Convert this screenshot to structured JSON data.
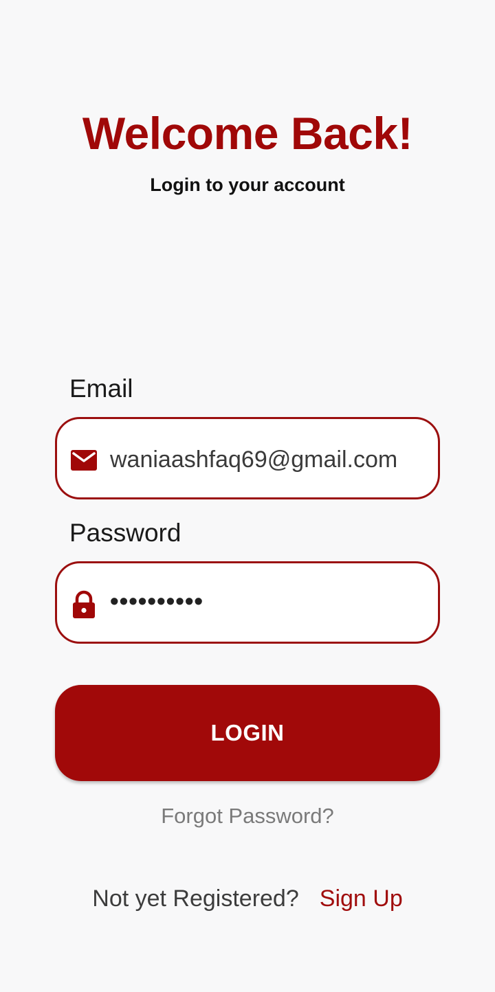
{
  "header": {
    "title": "Welcome Back!",
    "subtitle": "Login to your account"
  },
  "form": {
    "email": {
      "label": "Email",
      "value": "waniaashfaq69@gmail.com",
      "icon": "mail-icon"
    },
    "password": {
      "label": "Password",
      "value": "••••••••••",
      "icon": "lock-icon"
    },
    "login_label": "LOGIN",
    "forgot_label": "Forgot Password?"
  },
  "footer": {
    "prompt": "Not yet Registered?",
    "signup_label": "Sign Up"
  },
  "colors": {
    "accent": "#a10909",
    "background": "#f8f8f9",
    "muted_text": "#7a7a7a"
  }
}
